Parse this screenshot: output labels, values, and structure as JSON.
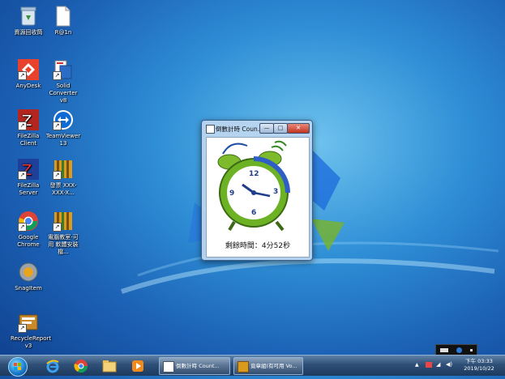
{
  "desktop": {
    "icons": [
      {
        "label": "資源回收筒",
        "icon": "recycle-bin-icon"
      },
      {
        "label": "R@1n",
        "icon": "document-icon"
      },
      {
        "label": "AnyDesk",
        "icon": "anydesk-icon"
      },
      {
        "label": "Solid Converter v8",
        "icon": "solid-converter-icon"
      },
      {
        "label": "FileZilla Client",
        "icon": "filezilla-client-icon"
      },
      {
        "label": "TeamViewer 13",
        "icon": "teamviewer-icon"
      },
      {
        "label": "FileZilla Server",
        "icon": "filezilla-server-icon"
      },
      {
        "label": "發票 XXX-XXX-X...",
        "icon": "archive-icon"
      },
      {
        "label": "Google Chrome",
        "icon": "chrome-icon"
      },
      {
        "label": "電腦教室-可用 軟體安裝檔...",
        "icon": "archive-icon"
      },
      {
        "label": "SnagItem",
        "icon": "snagit-icon"
      },
      {
        "label": "RecycleReport v3",
        "icon": "report-icon"
      }
    ]
  },
  "window": {
    "title": "倒數計時 Coun...",
    "minimize": "—",
    "maximize": "□",
    "close": "✕",
    "clock_numbers": [
      "12",
      "3",
      "6",
      "9"
    ],
    "remaining_text": "剩餘時間：4分52秒"
  },
  "taskbar": {
    "pinned": [
      "ie-icon",
      "chrome-icon",
      "explorer-icon",
      "media-player-icon"
    ],
    "buttons": [
      {
        "label": "倒數計時 Count...",
        "icon": "countdown-window-icon"
      },
      {
        "label": "竟章組(有可用 Vo...",
        "icon": "folder-icon"
      }
    ],
    "tray": {
      "time": "下午 03:33",
      "date": "2019/10/22"
    }
  },
  "colors": {
    "taskbar_top": "#5f82a8",
    "taskbar_bottom": "#1d3a5e",
    "close_button": "#c2321f",
    "desktop_accent": "#2f8fd6"
  }
}
